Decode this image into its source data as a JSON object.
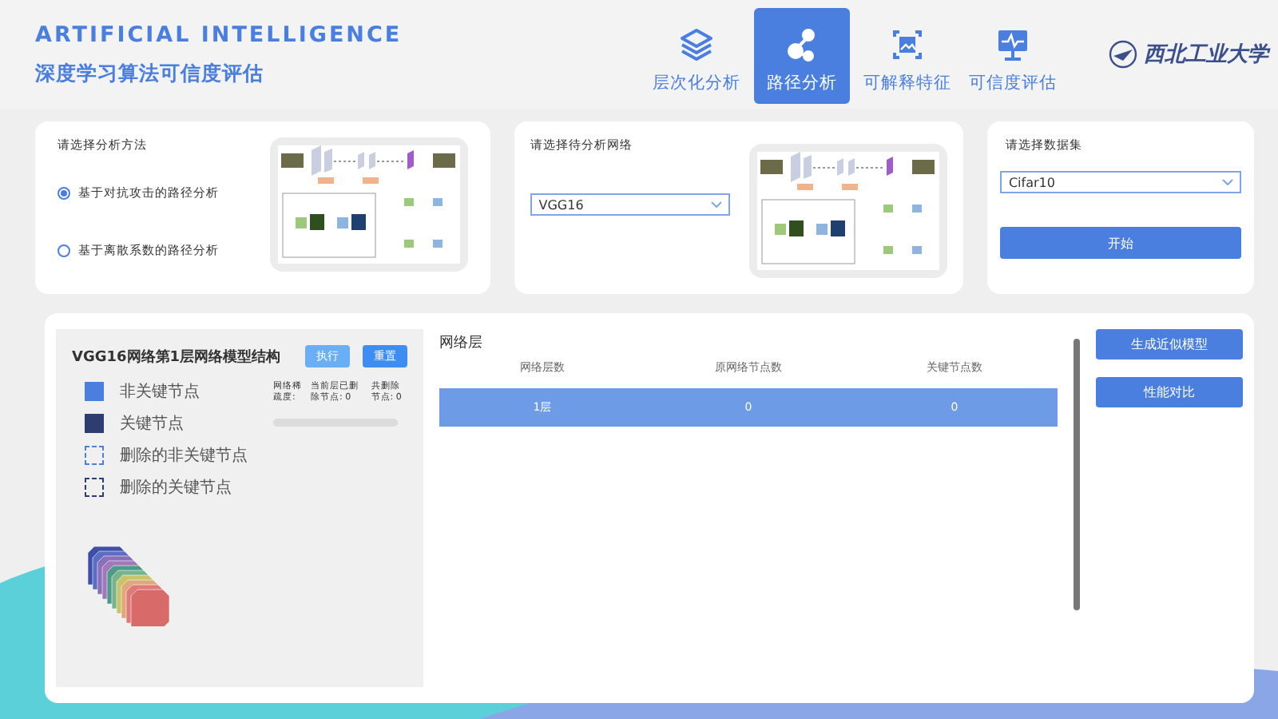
{
  "header": {
    "title": "ARTIFICIAL INTELLIGENCE",
    "subtitle": "深度学习算法可信度评估",
    "logo_text": "西北工业大学"
  },
  "nav": [
    {
      "label": "层次化分析",
      "selected": false
    },
    {
      "label": "路径分析",
      "selected": true
    },
    {
      "label": "可解释特征",
      "selected": false
    },
    {
      "label": "可信度评估",
      "selected": false
    }
  ],
  "method": {
    "title": "请选择分析方法",
    "options": [
      {
        "label": "基于对抗攻击的路径分析",
        "selected": true
      },
      {
        "label": "基于离散系数的路径分析",
        "selected": false
      }
    ]
  },
  "network": {
    "title": "请选择待分析网络",
    "value": "VGG16"
  },
  "dataset": {
    "title": "请选择数据集",
    "value": "Cifar10",
    "button": "开始"
  },
  "structure": {
    "title": "VGG16网络第1层网络模型结构",
    "buttons": [
      "执行",
      "重置"
    ],
    "legend": [
      {
        "label": "非关键节点",
        "kind": "filled",
        "color": "#4a7fe0"
      },
      {
        "label": "关键节点",
        "kind": "filled",
        "color": "#2e3d6e"
      },
      {
        "label": "删除的非关键节点",
        "kind": "dashed",
        "color": "#4a7fe0"
      },
      {
        "label": "删除的关键节点",
        "kind": "dashed",
        "color": "#2e3d6e"
      }
    ],
    "stats": [
      "网络稀疏度:",
      "当前层已删除节点: 0",
      "共删除节点: 0"
    ],
    "progress": {
      "level": 0
    }
  },
  "table": {
    "title": "网络层",
    "columns": [
      "网络层数",
      "原网络节点数",
      "关键节点数"
    ],
    "rows": [
      {
        "cells": [
          "1层",
          "0",
          "0"
        ],
        "selected": true
      }
    ]
  },
  "actions": [
    "生成近似模型",
    "性能对比"
  ]
}
